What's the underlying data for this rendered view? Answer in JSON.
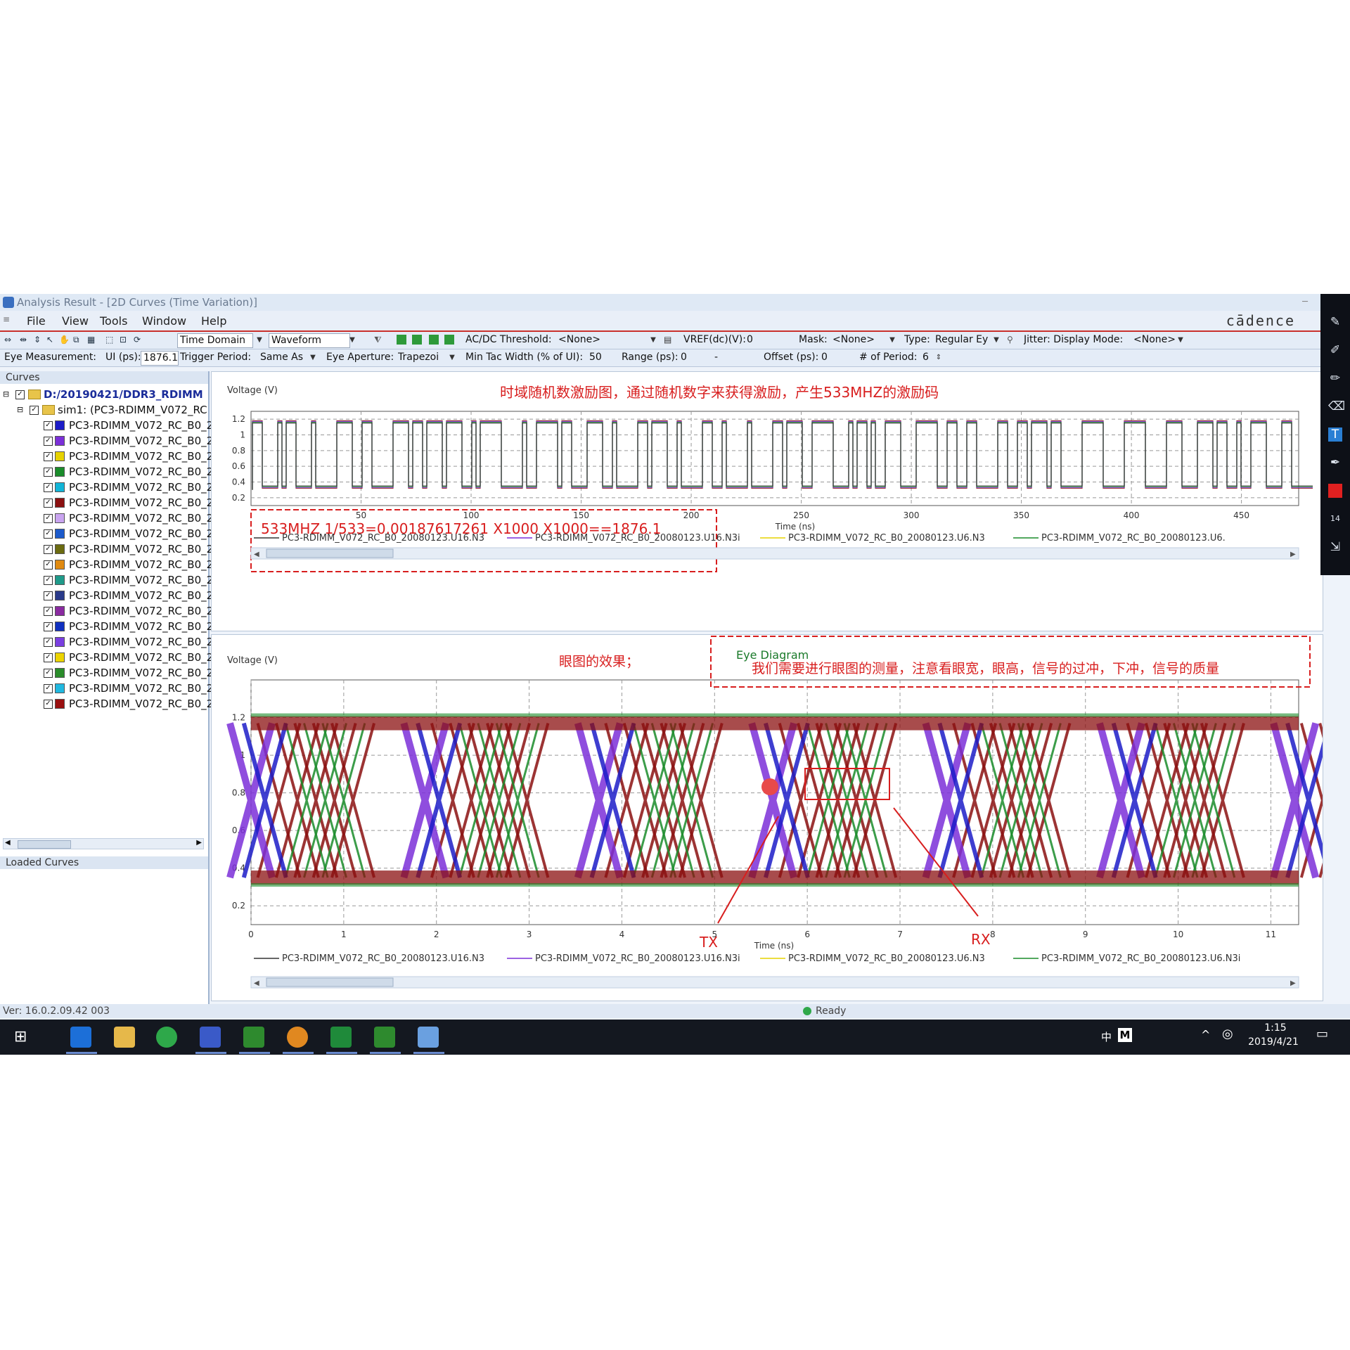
{
  "window": {
    "title": "Analysis Result - [2D Curves (Time Variation)]",
    "brand": "cādence",
    "menu": [
      "File",
      "View",
      "Tools",
      "Window",
      "Help"
    ]
  },
  "toolbar1": {
    "domain": "Time Domain",
    "plot_type": "Waveform",
    "acdc_label": "AC/DC Threshold:",
    "acdc_value": "<None>",
    "vref_label": "VREF(dc)(V):",
    "vref_value": "0",
    "mask_label": "Mask:",
    "mask_value": "<None>",
    "type_label": "Type:",
    "type_value": "Regular Ey",
    "jitter_label": "Jitter: Display Mode:",
    "jitter_value": "<None>"
  },
  "toolbar2": {
    "eye_meas_label": "Eye Measurement:",
    "ui_label": "UI (ps):",
    "ui_value": "1876.1",
    "trigger_label": "Trigger Period:",
    "trigger_value": "Same As",
    "aperture_label": "Eye Aperture:",
    "aperture_value": "Trapezoi",
    "mintac_label": "Min Tac Width (% of UI):",
    "mintac_value": "50",
    "range_label": "Range (ps):",
    "range_value": "0",
    "range_value2": "-",
    "offset_label": "Offset (ps):",
    "offset_value": "0",
    "periods_label": "# of Period:",
    "periods_value": "6"
  },
  "curves_panel": {
    "header": "Curves",
    "root": "D:/20190421/DDR3_RDIMM",
    "sim": "sim1: (PC3-RDIMM_V072_RC",
    "items": [
      {
        "label": "PC3-RDIMM_V072_RC_B0_2",
        "color": "#1c1cc8"
      },
      {
        "label": "PC3-RDIMM_V072_RC_B0_2",
        "color": "#7b2fd8"
      },
      {
        "label": "PC3-RDIMM_V072_RC_B0_2",
        "color": "#e6d200"
      },
      {
        "label": "PC3-RDIMM_V072_RC_B0_2",
        "color": "#1a8c2a"
      },
      {
        "label": "PC3-RDIMM_V072_RC_B0_2",
        "color": "#12b5d8"
      },
      {
        "label": "PC3-RDIMM_V072_RC_B0_2",
        "color": "#8b1010"
      },
      {
        "label": "PC3-RDIMM_V072_RC_B0_2",
        "color": "#c9a4f0"
      },
      {
        "label": "PC3-RDIMM_V072_RC_B0_2",
        "color": "#1c5acb"
      },
      {
        "label": "PC3-RDIMM_V072_RC_B0_2",
        "color": "#6b6b10"
      },
      {
        "label": "PC3-RDIMM_V072_RC_B0_2",
        "color": "#e08a10"
      },
      {
        "label": "PC3-RDIMM_V072_RC_B0_2",
        "color": "#1f9a8a"
      },
      {
        "label": "PC3-RDIMM_V072_RC_B0_2",
        "color": "#2a3a8a"
      },
      {
        "label": "PC3-RDIMM_V072_RC_B0_2",
        "color": "#8a2aa0"
      },
      {
        "label": "PC3-RDIMM_V072_RC_B0_2",
        "color": "#1030c0"
      },
      {
        "label": "PC3-RDIMM_V072_RC_B0_2",
        "color": "#7a3fe0"
      },
      {
        "label": "PC3-RDIMM_V072_RC_B0_2",
        "color": "#ecd400"
      },
      {
        "label": "PC3-RDIMM_V072_RC_B0_2",
        "color": "#2a8c2a"
      },
      {
        "label": "PC3-RDIMM_V072_RC_B0_2",
        "color": "#20b8e0"
      },
      {
        "label": "PC3-RDIMM_V072_RC_B0_2",
        "color": "#9a1010"
      }
    ],
    "loaded_header": "Loaded Curves"
  },
  "waveform_plot": {
    "ylabel": "Voltage (V)",
    "xlabel": "Time (ns)",
    "yticks": [
      "1.2",
      "1",
      "0.8",
      "0.6",
      "0.4",
      "0.2"
    ],
    "xticks": [
      "50",
      "100",
      "150",
      "200",
      "250",
      "300",
      "350",
      "400",
      "450"
    ],
    "legend": [
      {
        "label": "PC3-RDIMM_V072_RC_B0_20080123.U16.N3",
        "color": "#333333"
      },
      {
        "label": "PC3-RDIMM_V072_RC_B0_20080123.U16.N3i",
        "color": "#7b2fd8"
      },
      {
        "label": "PC3-RDIMM_V072_RC_B0_20080123.U6.N3",
        "color": "#e6d200"
      },
      {
        "label": "PC3-RDIMM_V072_RC_B0_20080123.U6.",
        "color": "#1a8c2a"
      }
    ],
    "annotation": "时域随机数激励图，通过随机数字来获得激励，产生533MHZ的激励码",
    "formula": "533MHZ 1/533=0.00187617261 X1000 X1000==1876.1"
  },
  "eye_plot": {
    "title": "Eye Diagram",
    "ylabel": "Voltage (V)",
    "xlabel": "Time (ns)",
    "yticks": [
      "1.2",
      "1",
      "0.8",
      "0.6",
      "0.4",
      "0.2"
    ],
    "xticks": [
      "0",
      "1",
      "2",
      "3",
      "4",
      "5",
      "6",
      "7",
      "8",
      "9",
      "10",
      "11"
    ],
    "legend": [
      {
        "label": "PC3-RDIMM_V072_RC_B0_20080123.U16.N3",
        "color": "#333333"
      },
      {
        "label": "PC3-RDIMM_V072_RC_B0_20080123.U16.N3i",
        "color": "#7b2fd8"
      },
      {
        "label": "PC3-RDIMM_V072_RC_B0_20080123.U6.N3",
        "color": "#e6d200"
      },
      {
        "label": "PC3-RDIMM_V072_RC_B0_20080123.U6.N3i",
        "color": "#1a8c2a"
      }
    ],
    "annotation_effect": "眼图的效果；",
    "annotation_measure": "我们需要进行眼图的测量，注意看眼宽，眼高，信号的过冲，下冲，信号的质量",
    "tx_label": "TX",
    "rx_label": "RX"
  },
  "status": {
    "version": "Ver: 16.0.2.09.42 003",
    "ready": "Ready"
  },
  "taskbar": {
    "lang": "中",
    "ime": "M",
    "time": "1:15",
    "date": "2019/4/21"
  },
  "colors": {
    "annotation_red": "#d81e1e",
    "accent": "#1c5acb"
  }
}
